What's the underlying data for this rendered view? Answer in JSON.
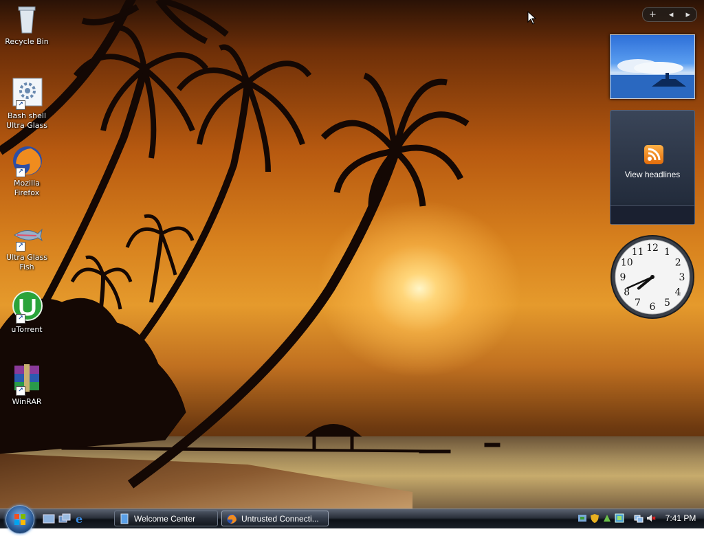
{
  "desktop": {
    "icons": [
      {
        "label": "Recycle Bin",
        "icon": "recycle-bin-icon"
      },
      {
        "label": "Bash shell\nUltra Glass",
        "icon": "bash-shell-icon"
      },
      {
        "label": "Mozilla\nFirefox",
        "icon": "firefox-icon"
      },
      {
        "label": "Ultra Glass\nFish",
        "icon": "fish-icon"
      },
      {
        "label": "uTorrent",
        "icon": "utorrent-icon"
      },
      {
        "label": "WinRAR",
        "icon": "winrar-icon"
      }
    ]
  },
  "sidebar": {
    "controls": {
      "add": "+",
      "prev": "◂",
      "next": "▸"
    },
    "feed_headlines": {
      "label": "View headlines",
      "icon": "rss-feed-icon"
    },
    "clock": {
      "hour": 7,
      "minute": 41,
      "numerals": [
        "12",
        "1",
        "2",
        "3",
        "4",
        "5",
        "6",
        "7",
        "8",
        "9",
        "10",
        "11"
      ]
    }
  },
  "taskbar": {
    "start_icon": "windows-start-orb",
    "quick_launch": [
      "show-desktop-icon",
      "switch-windows-icon",
      "internet-explorer-icon"
    ],
    "buttons": [
      {
        "label": "Welcome Center",
        "icon": "welcome-center-icon",
        "active": false
      },
      {
        "label": "Untrusted Connecti...",
        "icon": "firefox-icon",
        "active": true
      }
    ],
    "tray": {
      "icons": [
        "network-status-icon",
        "windows-defender-icon",
        "tray-app-icon",
        "tray-app2-icon",
        "network-icon",
        "volume-muted-icon"
      ],
      "time": "7:41 PM"
    }
  },
  "colors": {
    "sky_top": "#2a1206",
    "sky_sunset": "#e59a2c",
    "taskbar": "#1a2028",
    "accent_blue": "#2e5f9c",
    "feed_orange": "#e36c0a"
  }
}
